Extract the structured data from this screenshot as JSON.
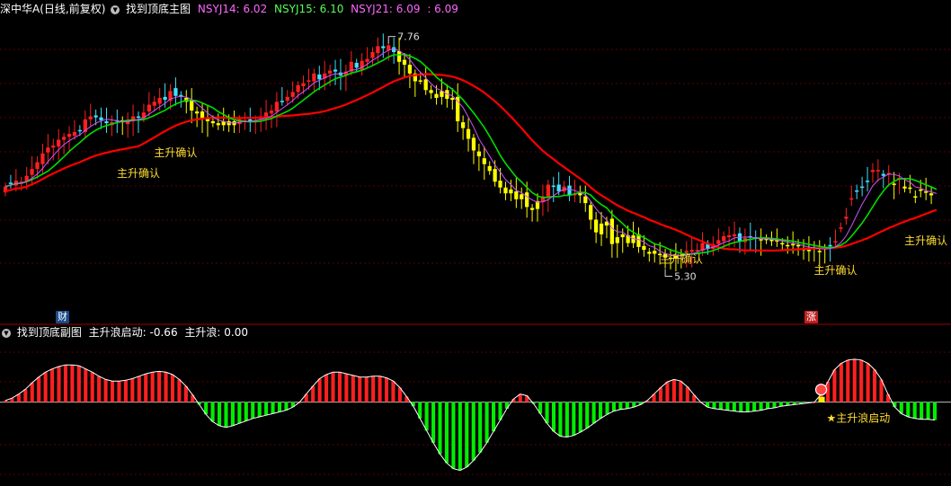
{
  "header": {
    "stock": "深中华A(日线,前复权)",
    "indicator": "找到顶底主图",
    "items": [
      {
        "label": "NSYJ14: 6.02",
        "color": "#ff66ff"
      },
      {
        "label": "NSYJ15: 6.10",
        "color": "#55ff55"
      },
      {
        "label": "NSYJ21: 6.09",
        "color": "#ff66ff"
      },
      {
        "label": ": 6.09",
        "color": "#ff66ff"
      }
    ]
  },
  "sub_header": {
    "indicator": "找到顶底副图",
    "items": [
      {
        "label": "主升浪启动: -0.66"
      },
      {
        "label": "主升浪: 0.00"
      }
    ]
  },
  "badges": {
    "fin": "财",
    "rise": "涨"
  },
  "chart_data": [
    {
      "type": "candlestick",
      "price_range": [
        5.0,
        7.95
      ],
      "high_label": "7.76",
      "low_label": "5.30",
      "high_value": 7.76,
      "low_value": 5.3,
      "colors": {
        "up": "#ff2020",
        "down": "#40e0ff",
        "yellow": "#ffff00",
        "ma_red": "#ff0000",
        "ma_green": "#00dd00",
        "ma_purple": "#cc55ff"
      },
      "annotations": [
        {
          "text": "主升确认",
          "index": 35
        },
        {
          "text": "主升确认",
          "index": 45
        },
        {
          "text": "主升确认",
          "index": 181
        },
        {
          "text": "主升确认",
          "index": 223
        },
        {
          "text": "主升确认",
          "index": 247
        }
      ],
      "series": [
        {
          "name": "NSYJ14",
          "values": [
            6.02
          ]
        },
        {
          "name": "NSYJ15",
          "values": [
            6.1
          ]
        },
        {
          "name": "NSYJ21",
          "values": [
            6.09
          ]
        }
      ],
      "close": [
        6.22,
        6.25,
        6.28,
        6.27,
        6.33,
        6.4,
        6.47,
        6.56,
        6.62,
        6.64,
        6.7,
        6.73,
        6.76,
        6.78,
        6.79,
        6.91,
        6.94,
        6.93,
        6.9,
        6.87,
        6.88,
        6.89,
        6.88,
        6.9,
        6.94,
        6.93,
        6.98,
        7.06,
        7.09,
        7.13,
        7.11,
        7.2,
        7.15,
        7.14,
        7.09,
        7.0,
        6.97,
        6.92,
        6.89,
        6.89,
        6.85,
        6.89,
        6.85,
        6.89,
        6.91,
        6.9,
        6.89,
        6.9,
        6.94,
        6.98,
        7.0,
        7.09,
        7.09,
        7.14,
        7.19,
        7.26,
        7.28,
        7.31,
        7.38,
        7.32,
        7.38,
        7.41,
        7.4,
        7.36,
        7.4,
        7.5,
        7.44,
        7.51,
        7.53,
        7.6,
        7.66,
        7.64,
        7.67,
        7.6,
        7.5,
        7.47,
        7.38,
        7.3,
        7.31,
        7.21,
        7.18,
        7.13,
        7.2,
        7.12,
        7.13,
        6.89,
        6.82,
        6.71,
        6.59,
        6.53,
        6.45,
        6.38,
        6.27,
        6.21,
        6.15,
        6.19,
        6.09,
        6.14,
        6.01,
        5.98,
        6.07,
        6.12,
        6.24,
        6.22,
        6.17,
        6.22,
        6.13,
        6.15,
        6.13,
        6.05,
        5.88,
        5.75,
        5.84,
        5.86,
        5.63,
        5.7,
        5.73,
        5.64,
        5.72,
        5.6,
        5.57,
        5.53,
        5.56,
        5.52,
        5.49,
        5.49,
        5.51,
        5.52,
        5.56,
        5.57,
        5.57,
        5.64,
        5.58,
        5.63,
        5.67,
        5.71,
        5.72,
        5.73,
        5.66,
        5.69,
        5.7,
        5.69,
        5.67,
        5.67,
        5.66,
        5.67,
        5.64,
        5.61,
        5.62,
        5.61,
        5.58,
        5.57,
        5.59,
        5.56,
        5.59,
        5.61,
        5.66,
        5.8,
        5.91,
        6.1,
        6.17,
        6.21,
        6.27,
        6.39,
        6.39,
        6.33,
        6.36,
        6.25,
        6.31,
        6.2,
        6.21,
        6.11,
        6.19,
        6.17,
        6.15,
        6.12
      ],
      "open": [
        6.16,
        6.26,
        6.23,
        6.25,
        6.27,
        6.34,
        6.4,
        6.45,
        6.57,
        6.62,
        6.63,
        6.7,
        6.73,
        6.74,
        6.8,
        6.78,
        6.91,
        6.95,
        6.93,
        6.89,
        6.85,
        6.9,
        6.9,
        6.86,
        6.89,
        6.94,
        6.92,
        6.99,
        7.05,
        7.07,
        7.14,
        7.1,
        7.23,
        7.16,
        7.13,
        7.11,
        6.99,
        6.99,
        6.93,
        6.87,
        6.87,
        6.85,
        6.89,
        6.85,
        6.86,
        6.9,
        6.91,
        6.88,
        6.91,
        6.94,
        6.97,
        6.99,
        7.1,
        7.1,
        7.14,
        7.19,
        7.25,
        7.3,
        7.3,
        7.37,
        7.33,
        7.38,
        7.42,
        7.39,
        7.36,
        7.4,
        7.49,
        7.42,
        7.5,
        7.54,
        7.59,
        7.66,
        7.62,
        7.65,
        7.61,
        7.52,
        7.47,
        7.38,
        7.31,
        7.32,
        7.21,
        7.17,
        7.14,
        7.21,
        7.11,
        7.14,
        6.88,
        6.81,
        6.72,
        6.58,
        6.51,
        6.43,
        6.4,
        6.28,
        6.21,
        6.15,
        6.17,
        6.09,
        6.16,
        6.0,
        5.99,
        6.06,
        6.11,
        6.23,
        6.24,
        6.17,
        6.23,
        6.13,
        6.16,
        6.12,
        6.03,
        5.88,
        5.73,
        5.82,
        5.89,
        5.64,
        5.7,
        5.72,
        5.64,
        5.73,
        5.61,
        5.55,
        5.53,
        5.53,
        5.53,
        5.49,
        5.48,
        5.52,
        5.54,
        5.55,
        5.56,
        5.56,
        5.63,
        5.58,
        5.63,
        5.66,
        5.7,
        5.71,
        5.74,
        5.65,
        5.71,
        5.7,
        5.68,
        5.69,
        5.68,
        5.66,
        5.64,
        5.62,
        5.63,
        5.62,
        5.58,
        5.57,
        5.58,
        5.55,
        5.58,
        5.62,
        5.65,
        5.8,
        5.89,
        6.09,
        6.18,
        6.22,
        6.28,
        6.37,
        6.39,
        6.35,
        6.36,
        6.24,
        6.3,
        6.22,
        6.2,
        6.12,
        6.18,
        6.16,
        6.13
      ]
    },
    {
      "type": "bar",
      "title": "主升浪启动",
      "value_range": [
        -1.0,
        0.75
      ],
      "star_label": "★主升浪启动",
      "colors": {
        "positive": "#ff2020",
        "negative": "#00ee00",
        "curve": "#ffffff"
      },
      "values": [
        0.02,
        0.05,
        0.1,
        0.16,
        0.24,
        0.31,
        0.37,
        0.41,
        0.44,
        0.46,
        0.46,
        0.45,
        0.41,
        0.37,
        0.32,
        0.28,
        0.26,
        0.26,
        0.27,
        0.29,
        0.32,
        0.35,
        0.37,
        0.38,
        0.37,
        0.34,
        0.28,
        0.2,
        0.09,
        -0.03,
        -0.15,
        -0.24,
        -0.29,
        -0.31,
        -0.29,
        -0.26,
        -0.23,
        -0.2,
        -0.18,
        -0.16,
        -0.14,
        -0.12,
        -0.1,
        -0.06,
        0.0,
        0.1,
        0.2,
        0.29,
        0.34,
        0.37,
        0.37,
        0.35,
        0.33,
        0.31,
        0.31,
        0.32,
        0.32,
        0.3,
        0.26,
        0.18,
        0.07,
        -0.05,
        -0.2,
        -0.35,
        -0.5,
        -0.64,
        -0.75,
        -0.82,
        -0.84,
        -0.8,
        -0.72,
        -0.62,
        -0.5,
        -0.36,
        -0.22,
        -0.08,
        0.04,
        0.1,
        0.08,
        -0.02,
        -0.14,
        -0.26,
        -0.36,
        -0.42,
        -0.43,
        -0.41,
        -0.37,
        -0.32,
        -0.26,
        -0.2,
        -0.15,
        -0.11,
        -0.09,
        -0.08,
        -0.06,
        -0.03,
        0.02,
        0.1,
        0.18,
        0.25,
        0.28,
        0.26,
        0.19,
        0.09,
        0.0,
        -0.06,
        -0.08,
        -0.09,
        -0.1,
        -0.11,
        -0.12,
        -0.12,
        -0.11,
        -0.1,
        -0.08,
        -0.07,
        -0.05,
        -0.04,
        -0.03,
        -0.02,
        -0.01,
        0.0,
        0.1,
        0.25,
        0.4,
        0.48,
        0.52,
        0.53,
        0.52,
        0.48,
        0.4,
        0.28,
        0.1,
        -0.06,
        -0.14,
        -0.18,
        -0.2,
        -0.21,
        -0.21,
        -0.22
      ]
    }
  ]
}
